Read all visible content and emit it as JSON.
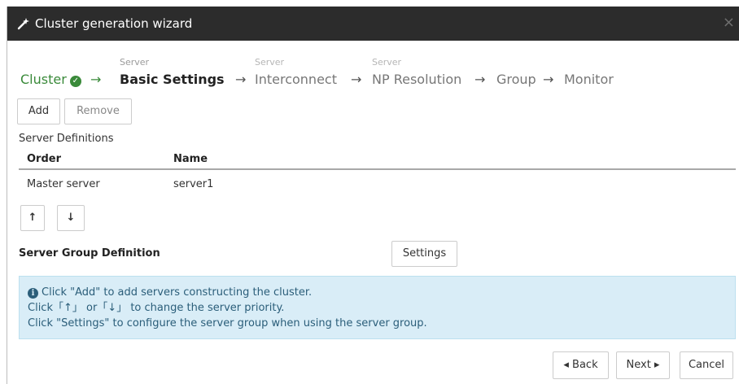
{
  "window": {
    "title": "Cluster generation wizard",
    "close_glyph": "×"
  },
  "steps": [
    {
      "sub": "",
      "label": "Cluster",
      "state": "done"
    },
    {
      "sub": "Server",
      "label": "Basic Settings",
      "state": "current"
    },
    {
      "sub": "Server",
      "label": "Interconnect",
      "state": "future"
    },
    {
      "sub": "Server",
      "label": "NP Resolution",
      "state": "future"
    },
    {
      "sub": "",
      "label": "Group",
      "state": "future"
    },
    {
      "sub": "",
      "label": "Monitor",
      "state": "future"
    }
  ],
  "step_arrow": "→",
  "toolbar": {
    "add_label": "Add",
    "remove_label": "Remove"
  },
  "server_definitions": {
    "heading": "Server Definitions",
    "columns": [
      "Order",
      "Name"
    ],
    "rows": [
      {
        "order": "Master server",
        "name": "server1"
      }
    ]
  },
  "priority": {
    "up_glyph": "↑",
    "down_glyph": "↓"
  },
  "server_group": {
    "label": "Server Group Definition",
    "settings_label": "Settings"
  },
  "info": {
    "icon": "i",
    "line1": "Click \"Add\" to add servers constructing the cluster.",
    "line2": "Click「↑」 or「↓」 to change the server priority.",
    "line3": "Click \"Settings\" to configure the server group when using the server group."
  },
  "footer": {
    "back_label": "◂ Back",
    "next_label": "Next ▸",
    "cancel_label": "Cancel"
  },
  "colors": {
    "titlebar": "#2c2c2c",
    "done": "#3a8a3a",
    "info_bg": "#d9edf7",
    "info_text": "#2b5e7a"
  }
}
